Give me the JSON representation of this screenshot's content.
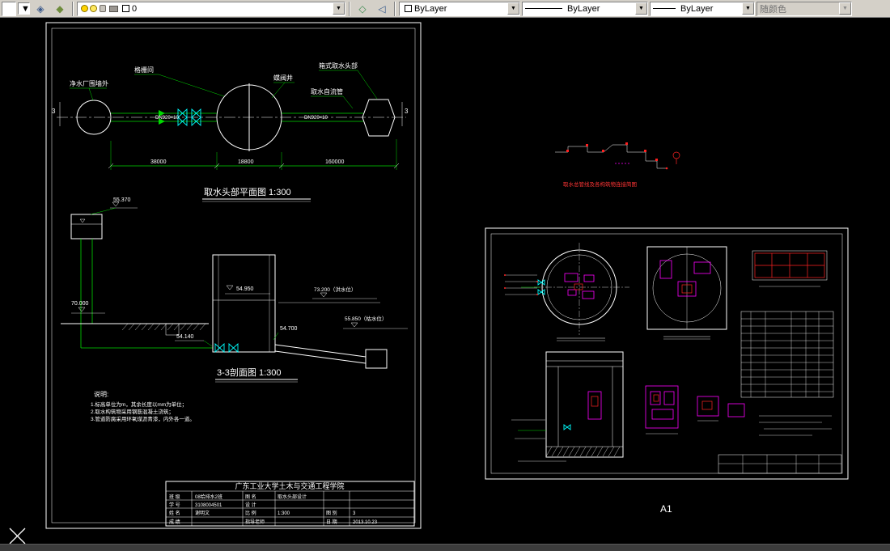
{
  "toolbar": {
    "layer_combo": {
      "value": "0"
    },
    "color_combo": {
      "value": "ByLayer"
    },
    "linetype_combo": {
      "value": "ByLayer"
    },
    "lineweight_combo": {
      "value": "ByLayer"
    },
    "plotstyle_combo": {
      "value": "随颜色"
    }
  },
  "plan": {
    "title": "取水头部平面图  1:300",
    "labels": {
      "fence": "净水厂围墙外",
      "screen_room": "格栅间",
      "valve_well": "蝶阀井",
      "intake_head": "箱式取水头部",
      "gravity_pipe": "取水自流管",
      "pipe_left": "DN920×10",
      "pipe_right": "DN920×10"
    },
    "dims": {
      "d1": "38000",
      "d2": "18800",
      "d3": "160000"
    },
    "section_mark_left": "3",
    "section_mark_right": "3"
  },
  "section": {
    "title": "3-3剖面图  1:300",
    "elev_pump": "55.370",
    "elev_ground": "70.000",
    "elev_top": "54.950",
    "elev_invert": "54.140",
    "elev_bottom": "54.700",
    "flood_level": "73.200（洪水位）",
    "low_level": "55.850（枯水位）"
  },
  "notes": {
    "title": "说明:",
    "line1": "1.标高单位为m，其余长度以mm为单位；",
    "line2": "2.取水构筑物采用钢筋混凝土浇筑；",
    "line3": "3.管道防腐采用环氧煤沥青漆，内外各一道。"
  },
  "titleblock": {
    "school": "广东工业大学土木与交通工程学院",
    "r1": [
      "班 级",
      "08给排水2班",
      "图 名",
      "取水头部设计"
    ],
    "r2": [
      "学 号",
      "3108004501",
      "设 计",
      ""
    ],
    "r3": [
      "姓 名",
      "谢明文",
      "比 例",
      "1:300",
      "图 别",
      "3"
    ],
    "r4": [
      "成 绩",
      "",
      "指导老师",
      "",
      "日 期",
      "2013.10.23"
    ]
  },
  "schematic": {
    "caption": "取水总管线及各构筑物连接简图"
  },
  "right_sheet": {
    "label": "A1"
  }
}
